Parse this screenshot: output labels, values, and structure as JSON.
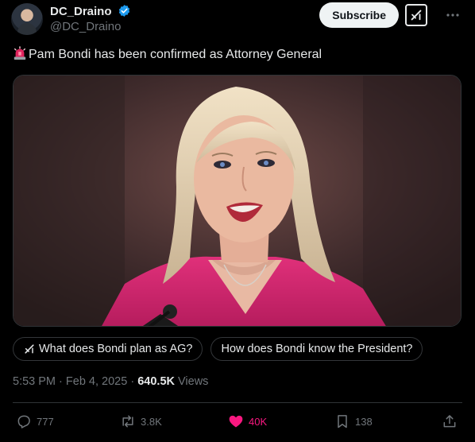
{
  "author": {
    "display_name": "DC_Draino",
    "handle": "@DC_Draino",
    "verified": true
  },
  "header": {
    "subscribe_label": "Subscribe",
    "grok_icon": "grok-icon",
    "more_icon": "more-icon"
  },
  "tweet": {
    "emoji_icon": "siren-emoji-icon",
    "text": "Pam Bondi has been confirmed as Attorney General"
  },
  "media": {
    "type": "photo"
  },
  "grok_suggestions": [
    {
      "label": "What does Bondi plan as AG?",
      "icon": "grok-icon"
    },
    {
      "label": "How does Bondi know the President?"
    }
  ],
  "meta": {
    "time": "5:53 PM",
    "separator": "·",
    "date": "Feb 4, 2025",
    "views_count": "640.5K",
    "views_label": "Views"
  },
  "actions": {
    "replies": "777",
    "reposts": "3.8K",
    "likes": "40K",
    "bookmarks": "138"
  },
  "colors": {
    "background": "#000000",
    "text": "#e7e9ea",
    "muted": "#71767b",
    "verified_blue": "#1d9bf0",
    "like_pink": "#f91880",
    "border": "#2f3336"
  }
}
